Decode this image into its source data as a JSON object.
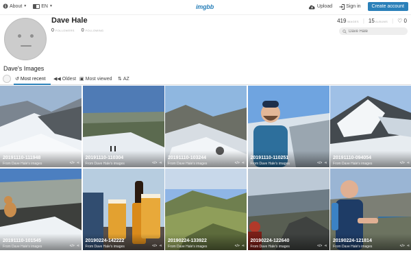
{
  "topbar": {
    "about_label": "About",
    "lang_label": "EN",
    "logo": "imgbb",
    "upload_label": "Upload",
    "signin_label": "Sign in",
    "create_label": "Create account"
  },
  "profile": {
    "name": "Dave Hale",
    "followers_count": "0",
    "followers_label": "FOLLOWERS",
    "following_count": "0",
    "following_label": "FOLLOWING",
    "images_count": "419",
    "images_label": "IMAGES",
    "albums_count": "15",
    "albums_label": "ALBUMS",
    "likes_count": "0",
    "search_placeholder": "Dave Hale"
  },
  "section_title": "Dave's Images",
  "tabs": [
    {
      "label": "Most recent",
      "active": true,
      "icon": "clock-icon"
    },
    {
      "label": "Oldest",
      "active": false,
      "icon": "rewind-icon"
    },
    {
      "label": "Most viewed",
      "active": false,
      "icon": "eye-icon"
    },
    {
      "label": "AZ",
      "active": false,
      "icon": "sort-icon"
    }
  ],
  "images": [
    {
      "title": "20191110-111948",
      "from": "From Dave Hale's images",
      "scene": "snowridge"
    },
    {
      "title": "20191110-110304",
      "from": "From Dave Hale's images",
      "scene": "valley"
    },
    {
      "title": "20191110-103244",
      "from": "From Dave Hale's images",
      "scene": "snowslope"
    },
    {
      "title": "20191110-110251",
      "from": "From Dave Hale's images",
      "scene": "selfie"
    },
    {
      "title": "20191110-094054",
      "from": "From Dave Hale's images",
      "scene": "snowpeak"
    },
    {
      "title": "20191110-101545",
      "from": "From Dave Hale's images",
      "scene": "dogsnow"
    },
    {
      "title": "20190224-142222",
      "from": "From Dave Hale's images",
      "scene": "beer"
    },
    {
      "title": "20190224-133922",
      "from": "From Dave Hale's images",
      "scene": "greenvalley"
    },
    {
      "title": "20190224-122640",
      "from": "From Dave Hale's images",
      "scene": "rocks"
    },
    {
      "title": "20190224-121814",
      "from": "From Dave Hale's images",
      "scene": "runner"
    }
  ]
}
